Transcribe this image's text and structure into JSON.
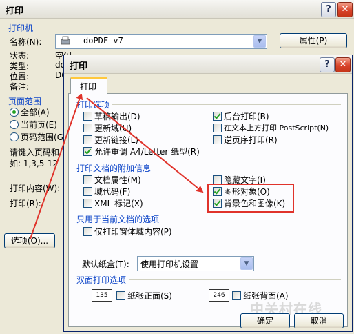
{
  "bg_window": {
    "title": "打印",
    "printer_group_title": "打印机",
    "name_label": "名称(N):",
    "printer_name": "doPDF v7",
    "properties_button": "属性(P)",
    "status_label": "状态:",
    "status_value": "空闲",
    "type_label": "类型:",
    "type_value": "do",
    "where_label": "位置:",
    "where_value": "DO",
    "comment_label": "备注:",
    "page_range_title": "页面范围",
    "range_all": "全部(A)",
    "range_current": "当前页(E)",
    "range_pages": "页码范围(G)",
    "pages_hint_1": "请键入页码和/",
    "pages_hint_2": "如: 1,3,5-12",
    "print_what_label": "打印内容(W):",
    "print_label": "打印(R):",
    "options_button": "选项(O)..."
  },
  "dialog": {
    "title": "打印",
    "help_button": "?",
    "close_button": "✕",
    "tab_print": "打印",
    "section_print_options": "打印选项",
    "cb_draft": "草稿输出(D)",
    "cb_update_fields": "更新域(U)",
    "cb_update_links": "更新链接(L)",
    "cb_a4_letter": "允许重调 A4/Letter 纸型(R)",
    "cb_background_print": "后台打印(B)",
    "cb_postscript": "在文本上方打印 PostScript(N)",
    "cb_reverse": "逆页序打印(R)",
    "section_doc_info": "打印文档的附加信息",
    "cb_doc_properties": "文档属性(M)",
    "cb_field_codes": "域代码(F)",
    "cb_xml_tags": "XML 标记(X)",
    "cb_hidden_text": "隐藏文字(I)",
    "cb_drawing_objects": "图形对象(O)",
    "cb_bg_colors": "背景色和图像(K)",
    "section_current_doc": "只用于当前文档的选项",
    "cb_form_data": "仅打印窗体域内容(P)",
    "default_tray_label": "默认纸盒(T):",
    "default_tray_value": "使用打印机设置",
    "section_duplex": "双面打印选项",
    "duplex_front_icon_text": "135",
    "duplex_front": "纸张正面(S)",
    "duplex_back_icon_text": "246",
    "duplex_back": "纸张背面(A)",
    "ok_button": "确定",
    "cancel_button": "取消"
  },
  "checked": {
    "cb_draft": false,
    "cb_update_fields": false,
    "cb_update_links": false,
    "cb_a4_letter": true,
    "cb_background_print": true,
    "cb_postscript": false,
    "cb_reverse": false,
    "cb_doc_properties": false,
    "cb_field_codes": false,
    "cb_xml_tags": false,
    "cb_hidden_text": false,
    "cb_drawing_objects": true,
    "cb_bg_colors": true,
    "cb_form_data": false,
    "duplex_front": false,
    "duplex_back": false
  },
  "watermark": "中关村在线",
  "colors": {
    "annotation_red": "#e0332b",
    "group_title_blue": "#1148c9",
    "dialog_face": "#ece9d8"
  }
}
